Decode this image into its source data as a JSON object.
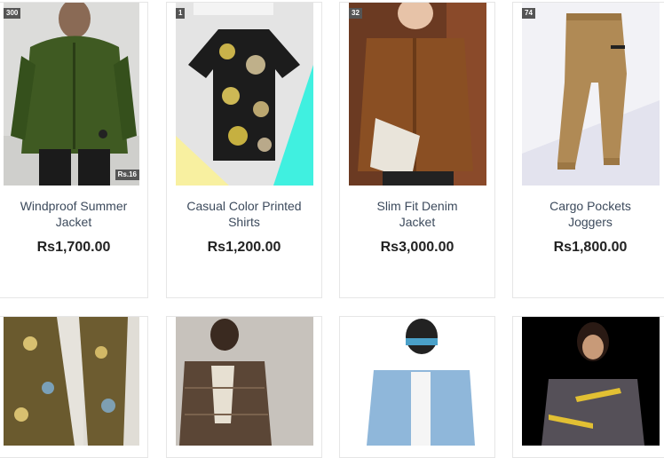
{
  "products": [
    {
      "title": "Windproof Summer Jacket",
      "price": "Rs1,700.00",
      "badge": "300",
      "badge2": "Rs.16",
      "image": "green-jacket-photo"
    },
    {
      "title": "Casual Color Printed Shirts",
      "price": "Rs1,200.00",
      "badge": "1",
      "image": "floral-shirt-photo"
    },
    {
      "title": "Slim Fit Denim Jacket",
      "price": "Rs3,000.00",
      "badge": "32",
      "image": "brown-denim-jacket-photo"
    },
    {
      "title": "Cargo Pockets Joggers",
      "price": "Rs1,800.00",
      "badge": "74",
      "image": "cargo-joggers-photo"
    },
    {
      "image": "printed-pants-photo"
    },
    {
      "image": "plaid-blazer-photo"
    },
    {
      "image": "blue-denim-jacket-photo"
    },
    {
      "image": "grey-track-jacket-photo"
    }
  ]
}
